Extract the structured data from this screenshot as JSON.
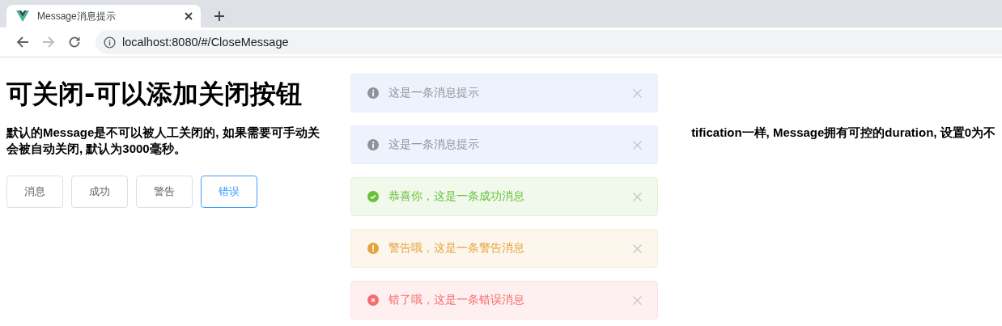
{
  "browser": {
    "tab_title": "Message消息提示",
    "url": "localhost:8080/#/CloseMessage",
    "forward_disabled": true
  },
  "page": {
    "heading": "可关闭-可以添加关闭按钮",
    "paragraph_line_1_left": "默认的Message是不可以被人工关闭的, 如果需要可手动关",
    "paragraph_line_1_right": "tification一样, Message拥有可控的duration, 设置0为不",
    "paragraph_line_2": "会被自动关闭, 默认为3000毫秒。"
  },
  "buttons": [
    {
      "label": "消息",
      "focused": false
    },
    {
      "label": "成功",
      "focused": false
    },
    {
      "label": "警告",
      "focused": false
    },
    {
      "label": "错误",
      "focused": true
    }
  ],
  "messages": [
    {
      "kind": "info",
      "text": "这是一条消息提示"
    },
    {
      "kind": "info",
      "text": "这是一条消息提示"
    },
    {
      "kind": "success",
      "text": "恭喜你，这是一条成功消息"
    },
    {
      "kind": "warning",
      "text": "警告哦，这是一条警告消息"
    },
    {
      "kind": "error",
      "text": "错了哦，这是一条错误消息"
    }
  ]
}
